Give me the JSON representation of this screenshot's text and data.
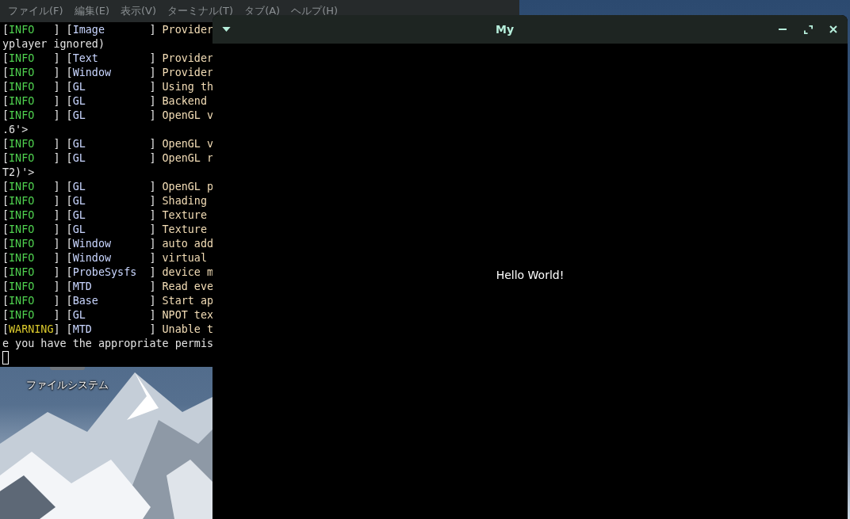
{
  "desktop": {
    "icons": [
      {
        "label": "ファイルシステム"
      }
    ]
  },
  "terminal": {
    "menu": [
      "ファイル(F)",
      "編集(E)",
      "表示(V)",
      "ターミナル(T)",
      "タブ(A)",
      "ヘルプ(H)"
    ],
    "lines": [
      {
        "segments": [
          {
            "kind": "bracket",
            "text": "["
          },
          {
            "kind": "info",
            "text": "INFO"
          },
          {
            "kind": "bracket",
            "text": "   ] ["
          },
          {
            "kind": "category",
            "text": "Image"
          },
          {
            "kind": "bracket",
            "text": "       ] "
          },
          {
            "kind": "message",
            "text": "Provider"
          }
        ]
      },
      {
        "segments": [
          {
            "kind": "plain",
            "text": "yplayer ignored)"
          }
        ]
      },
      {
        "segments": [
          {
            "kind": "bracket",
            "text": "["
          },
          {
            "kind": "info",
            "text": "INFO"
          },
          {
            "kind": "bracket",
            "text": "   ] ["
          },
          {
            "kind": "category",
            "text": "Text"
          },
          {
            "kind": "bracket",
            "text": "        ] "
          },
          {
            "kind": "message",
            "text": "Provider"
          }
        ]
      },
      {
        "segments": [
          {
            "kind": "bracket",
            "text": "["
          },
          {
            "kind": "info",
            "text": "INFO"
          },
          {
            "kind": "bracket",
            "text": "   ] ["
          },
          {
            "kind": "category",
            "text": "Window"
          },
          {
            "kind": "bracket",
            "text": "      ] "
          },
          {
            "kind": "message",
            "text": "Provider"
          }
        ]
      },
      {
        "segments": [
          {
            "kind": "bracket",
            "text": "["
          },
          {
            "kind": "info",
            "text": "INFO"
          },
          {
            "kind": "bracket",
            "text": "   ] ["
          },
          {
            "kind": "category",
            "text": "GL"
          },
          {
            "kind": "bracket",
            "text": "          ] "
          },
          {
            "kind": "message",
            "text": "Using th"
          }
        ]
      },
      {
        "segments": [
          {
            "kind": "bracket",
            "text": "["
          },
          {
            "kind": "info",
            "text": "INFO"
          },
          {
            "kind": "bracket",
            "text": "   ] ["
          },
          {
            "kind": "category",
            "text": "GL"
          },
          {
            "kind": "bracket",
            "text": "          ] "
          },
          {
            "kind": "message",
            "text": "Backend"
          }
        ]
      },
      {
        "segments": [
          {
            "kind": "bracket",
            "text": "["
          },
          {
            "kind": "info",
            "text": "INFO"
          },
          {
            "kind": "bracket",
            "text": "   ] ["
          },
          {
            "kind": "category",
            "text": "GL"
          },
          {
            "kind": "bracket",
            "text": "          ] "
          },
          {
            "kind": "message",
            "text": "OpenGL v"
          }
        ]
      },
      {
        "segments": [
          {
            "kind": "plain",
            "text": ".6'>"
          }
        ]
      },
      {
        "segments": [
          {
            "kind": "bracket",
            "text": "["
          },
          {
            "kind": "info",
            "text": "INFO"
          },
          {
            "kind": "bracket",
            "text": "   ] ["
          },
          {
            "kind": "category",
            "text": "GL"
          },
          {
            "kind": "bracket",
            "text": "          ] "
          },
          {
            "kind": "message",
            "text": "OpenGL v"
          }
        ]
      },
      {
        "segments": [
          {
            "kind": "bracket",
            "text": "["
          },
          {
            "kind": "info",
            "text": "INFO"
          },
          {
            "kind": "bracket",
            "text": "   ] ["
          },
          {
            "kind": "category",
            "text": "GL"
          },
          {
            "kind": "bracket",
            "text": "          ] "
          },
          {
            "kind": "message",
            "text": "OpenGL r"
          }
        ]
      },
      {
        "segments": [
          {
            "kind": "plain",
            "text": "T2)'>"
          }
        ]
      },
      {
        "segments": [
          {
            "kind": "bracket",
            "text": "["
          },
          {
            "kind": "info",
            "text": "INFO"
          },
          {
            "kind": "bracket",
            "text": "   ] ["
          },
          {
            "kind": "category",
            "text": "GL"
          },
          {
            "kind": "bracket",
            "text": "          ] "
          },
          {
            "kind": "message",
            "text": "OpenGL p"
          }
        ]
      },
      {
        "segments": [
          {
            "kind": "bracket",
            "text": "["
          },
          {
            "kind": "info",
            "text": "INFO"
          },
          {
            "kind": "bracket",
            "text": "   ] ["
          },
          {
            "kind": "category",
            "text": "GL"
          },
          {
            "kind": "bracket",
            "text": "          ] "
          },
          {
            "kind": "message",
            "text": "Shading"
          }
        ]
      },
      {
        "segments": [
          {
            "kind": "bracket",
            "text": "["
          },
          {
            "kind": "info",
            "text": "INFO"
          },
          {
            "kind": "bracket",
            "text": "   ] ["
          },
          {
            "kind": "category",
            "text": "GL"
          },
          {
            "kind": "bracket",
            "text": "          ] "
          },
          {
            "kind": "message",
            "text": "Texture"
          }
        ]
      },
      {
        "segments": [
          {
            "kind": "bracket",
            "text": "["
          },
          {
            "kind": "info",
            "text": "INFO"
          },
          {
            "kind": "bracket",
            "text": "   ] ["
          },
          {
            "kind": "category",
            "text": "GL"
          },
          {
            "kind": "bracket",
            "text": "          ] "
          },
          {
            "kind": "message",
            "text": "Texture"
          }
        ]
      },
      {
        "segments": [
          {
            "kind": "bracket",
            "text": "["
          },
          {
            "kind": "info",
            "text": "INFO"
          },
          {
            "kind": "bracket",
            "text": "   ] ["
          },
          {
            "kind": "category",
            "text": "Window"
          },
          {
            "kind": "bracket",
            "text": "      ] "
          },
          {
            "kind": "message",
            "text": "auto add"
          }
        ]
      },
      {
        "segments": [
          {
            "kind": "bracket",
            "text": "["
          },
          {
            "kind": "info",
            "text": "INFO"
          },
          {
            "kind": "bracket",
            "text": "   ] ["
          },
          {
            "kind": "category",
            "text": "Window"
          },
          {
            "kind": "bracket",
            "text": "      ] "
          },
          {
            "kind": "message",
            "text": "virtual"
          }
        ]
      },
      {
        "segments": [
          {
            "kind": "bracket",
            "text": "["
          },
          {
            "kind": "info",
            "text": "INFO"
          },
          {
            "kind": "bracket",
            "text": "   ] ["
          },
          {
            "kind": "category",
            "text": "ProbeSysfs"
          },
          {
            "kind": "bracket",
            "text": "  ] "
          },
          {
            "kind": "message",
            "text": "device m"
          }
        ]
      },
      {
        "segments": [
          {
            "kind": "bracket",
            "text": "["
          },
          {
            "kind": "info",
            "text": "INFO"
          },
          {
            "kind": "bracket",
            "text": "   ] ["
          },
          {
            "kind": "category",
            "text": "MTD"
          },
          {
            "kind": "bracket",
            "text": "         ] "
          },
          {
            "kind": "message",
            "text": "Read eve"
          }
        ]
      },
      {
        "segments": [
          {
            "kind": "bracket",
            "text": "["
          },
          {
            "kind": "info",
            "text": "INFO"
          },
          {
            "kind": "bracket",
            "text": "   ] ["
          },
          {
            "kind": "category",
            "text": "Base"
          },
          {
            "kind": "bracket",
            "text": "        ] "
          },
          {
            "kind": "message",
            "text": "Start ap"
          }
        ]
      },
      {
        "segments": [
          {
            "kind": "bracket",
            "text": "["
          },
          {
            "kind": "info",
            "text": "INFO"
          },
          {
            "kind": "bracket",
            "text": "   ] ["
          },
          {
            "kind": "category",
            "text": "GL"
          },
          {
            "kind": "bracket",
            "text": "          ] "
          },
          {
            "kind": "message",
            "text": "NPOT tex"
          }
        ]
      },
      {
        "segments": [
          {
            "kind": "bracket",
            "text": "["
          },
          {
            "kind": "warning",
            "text": "WARNING"
          },
          {
            "kind": "bracket",
            "text": "] ["
          },
          {
            "kind": "category",
            "text": "MTD"
          },
          {
            "kind": "bracket",
            "text": "         ] "
          },
          {
            "kind": "message",
            "text": "Unable t"
          }
        ]
      },
      {
        "segments": [
          {
            "kind": "plain",
            "text": "e you have the appropriate permis"
          }
        ]
      }
    ]
  },
  "app_window": {
    "title": "My",
    "content": "Hello World!"
  }
}
